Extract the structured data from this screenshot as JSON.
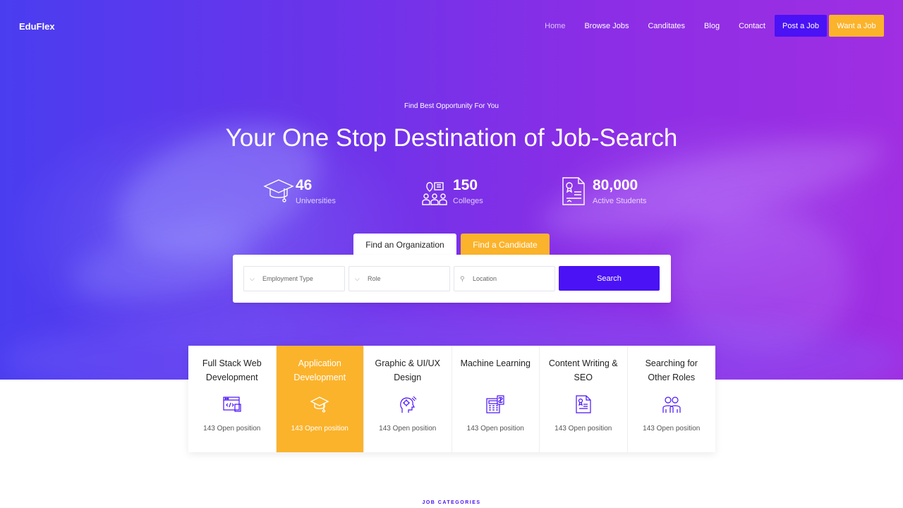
{
  "brand": {
    "logo": "EduFlex"
  },
  "nav": {
    "links": [
      "Home",
      "Browse Jobs",
      "Canditates",
      "Blog",
      "Contact"
    ],
    "post_job": "Post a Job",
    "want_job": "Want a Job"
  },
  "hero": {
    "tagline": "Find Best Opportunity For You",
    "headline": "Your One Stop Destination of Job-Search",
    "stats": [
      {
        "value": "46",
        "label": "Universities",
        "icon": "graduation-cap-icon"
      },
      {
        "value": "150",
        "label": "Colleges",
        "icon": "people-location-icon"
      },
      {
        "value": "80,000",
        "label": "Active Students",
        "icon": "certificate-icon"
      }
    ]
  },
  "search": {
    "tab_org": "Find an Organization",
    "tab_candidate": "Find a Candidate",
    "employment_type": "Employment Type",
    "role": "Role",
    "location": "Location",
    "button": "Search"
  },
  "categories": [
    {
      "title": "Full Stack Web Development",
      "count": "143 Open position",
      "icon": "code-window-icon"
    },
    {
      "title": "Application Development",
      "count": "143 Open position",
      "icon": "graduation-cap-icon"
    },
    {
      "title": "Graphic & UI/UX Design",
      "count": "143 Open position",
      "icon": "creative-mind-icon"
    },
    {
      "title": "Machine Learning",
      "count": "143 Open position",
      "icon": "calculator-icon"
    },
    {
      "title": "Content Writing & SEO",
      "count": "143 Open position",
      "icon": "document-icon"
    },
    {
      "title": "Searching for Other Roles",
      "count": "143 Open position",
      "icon": "team-icon"
    }
  ],
  "section": {
    "label": "JOB CATEGORIES"
  },
  "colors": {
    "primary": "#4a12f5",
    "accent": "#fbb32b"
  }
}
